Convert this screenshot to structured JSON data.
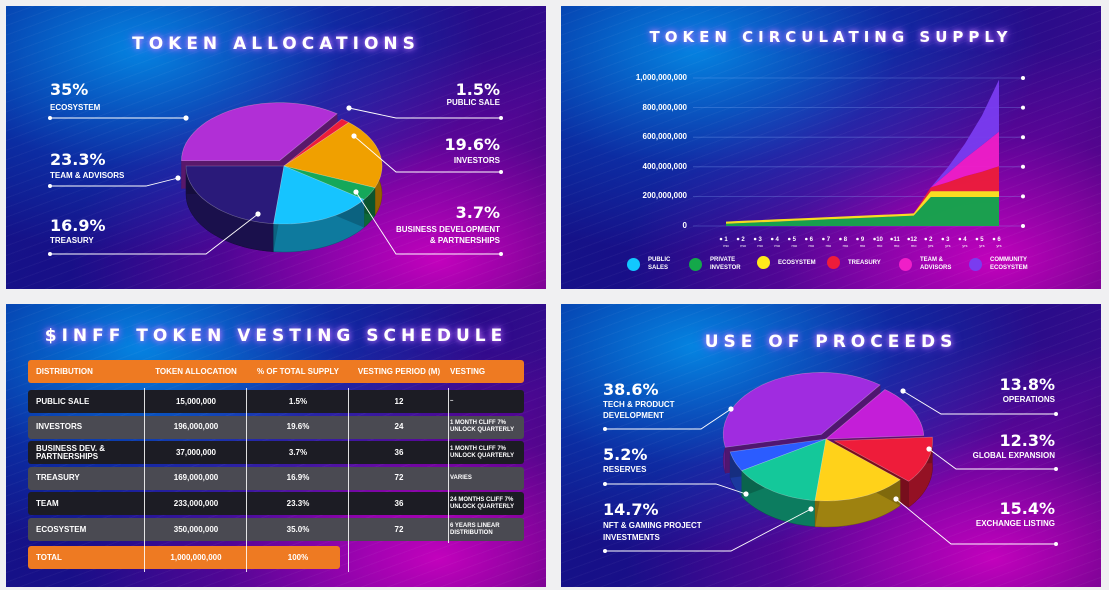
{
  "allocations": {
    "title": "TOKEN ALLOCATIONS",
    "colors": {
      "ecosystem": "#b12fd6",
      "team": "#2a1a7a",
      "treasury": "#16c4ff",
      "business": "#15a85a",
      "investors": "#f0a000",
      "public": "#ee1c3a",
      "yellow": "#ffe01a"
    },
    "chart_data": {
      "type": "pie",
      "title": "TOKEN ALLOCATIONS",
      "slices": [
        {
          "name": "ECOSYSTEM",
          "value": 35,
          "pct": "35%"
        },
        {
          "name": "TEAM & ADVISORS",
          "value": 23.3,
          "pct": "23.3%"
        },
        {
          "name": "TREASURY",
          "value": 16.9,
          "pct": "16.9%"
        },
        {
          "name": "BUSINESS DEVELOPMENT & PARTNERSHIPS",
          "value": 3.7,
          "pct": "3.7%"
        },
        {
          "name": "INVESTORS",
          "value": 19.6,
          "pct": "19.6%"
        },
        {
          "name": "PUBLIC SALE",
          "value": 1.5,
          "pct": "1.5%"
        }
      ]
    },
    "labels": {
      "eco_pct": "35%",
      "eco_name": "ECOSYSTEM",
      "team_pct": "23.3%",
      "team_name": "TEAM & ADVISORS",
      "tre_pct": "16.9%",
      "tre_name": "TREASURY",
      "pub_pct": "1.5%",
      "pub_name": "PUBLIC SALE",
      "inv_pct": "19.6%",
      "inv_name": "INVESTORS",
      "bus_pct": "3.7%",
      "bus_name1": "BUSINESS DEVELOPMENT",
      "bus_name2": "& PARTNERSHIPS"
    }
  },
  "supply": {
    "title": "TOKEN CIRCULATING SUPPLY",
    "chart_data": {
      "type": "area",
      "title": "TOKEN CIRCULATING SUPPLY",
      "ylim": [
        0,
        1000000000
      ],
      "yticks": [
        "1,000,000,000",
        "800,000,000",
        "600,000,000",
        "400,000,000",
        "200,000,000",
        "0"
      ],
      "ytick_values": [
        1000000000,
        800000000,
        600000000,
        400000000,
        200000000,
        0
      ],
      "x_labels": [
        {
          "n": "1",
          "u": "mo"
        },
        {
          "n": "2",
          "u": "mo"
        },
        {
          "n": "3",
          "u": "mo"
        },
        {
          "n": "4",
          "u": "mo"
        },
        {
          "n": "5",
          "u": "mo"
        },
        {
          "n": "6",
          "u": "mo"
        },
        {
          "n": "7",
          "u": "mo"
        },
        {
          "n": "8",
          "u": "mo"
        },
        {
          "n": "9",
          "u": "mo"
        },
        {
          "n": "10",
          "u": "mo"
        },
        {
          "n": "11",
          "u": "mo"
        },
        {
          "n": "12",
          "u": "mo"
        },
        {
          "n": "2",
          "u": "yrs"
        },
        {
          "n": "3",
          "u": "yrs"
        },
        {
          "n": "4",
          "u": "yrs"
        },
        {
          "n": "5",
          "u": "yrs"
        },
        {
          "n": "6",
          "u": "yrs"
        }
      ],
      "stacked": true,
      "series": [
        {
          "name": "PRIVATE INVESTOR",
          "color": "#14a84a",
          "values": [
            15000000,
            20000000,
            25000000,
            30000000,
            35000000,
            40000000,
            45000000,
            50000000,
            55000000,
            60000000,
            65000000,
            70000000,
            196000000,
            196000000,
            196000000,
            196000000,
            196000000
          ]
        },
        {
          "name": "ECOSYSTEM",
          "color": "#ffe81a",
          "values": [
            15000000,
            15000000,
            15000000,
            15000000,
            15000000,
            15000000,
            15000000,
            15000000,
            15000000,
            15000000,
            15000000,
            15000000,
            40000000,
            40000000,
            40000000,
            40000000,
            40000000
          ]
        },
        {
          "name": "TREASURY",
          "color": "#ee1c3a",
          "values": [
            0,
            0,
            0,
            0,
            0,
            0,
            0,
            0,
            0,
            0,
            0,
            0,
            25000000,
            60000000,
            100000000,
            130000000,
            169000000
          ]
        },
        {
          "name": "TEAM & ADVISORS",
          "color": "#f01ec8",
          "values": [
            0,
            0,
            0,
            0,
            0,
            0,
            0,
            0,
            0,
            0,
            0,
            0,
            0,
            60000000,
            120000000,
            180000000,
            233000000
          ]
        },
        {
          "name": "COMMUNITY ECOSYSTEM",
          "color": "#7a3cf0",
          "values": [
            0,
            0,
            0,
            0,
            0,
            0,
            0,
            0,
            0,
            0,
            0,
            0,
            0,
            40000000,
            100000000,
            200000000,
            350000000
          ]
        }
      ]
    },
    "legend": [
      {
        "label": "PUBLIC SALES",
        "l1": "PUBLIC",
        "l2": "SALES",
        "color": "#12c8ff"
      },
      {
        "label": "PRIVATE INVESTOR",
        "l1": "PRIVATE",
        "l2": "INVESTOR",
        "color": "#14a84a"
      },
      {
        "label": "ECOSYSTEM",
        "l1": "ECOSYSTEM",
        "l2": "",
        "color": "#ffe81a"
      },
      {
        "label": "TREASURY",
        "l1": "TREASURY",
        "l2": "",
        "color": "#ee1c3a"
      },
      {
        "label": "TEAM & ADVISORS",
        "l1": "TEAM &",
        "l2": "ADVISORS",
        "color": "#f01ec8"
      },
      {
        "label": "COMMUNITY ECOSYSTEM",
        "l1": "COMMUNITY",
        "l2": "ECOSYSTEM",
        "color": "#7a3cf0"
      }
    ]
  },
  "vesting": {
    "title": "$INFF TOKEN VESTING SCHEDULE",
    "chart_data": {
      "type": "table",
      "headers": [
        "DISTRIBUTION",
        "TOKEN ALLOCATION",
        "% OF TOTAL SUPPLY",
        "VESTING PERIOD (M)",
        "VESTING"
      ],
      "rows": [
        [
          "PUBLIC SALE",
          "15,000,000",
          "1.5%",
          "12",
          "–"
        ],
        [
          "INVESTORS",
          "196,000,000",
          "19.6%",
          "24",
          "1 MONTH CLIFF 7% UNLOCK QUARTERLY"
        ],
        [
          "BUSINESS DEV. & PARTNERSHIPS",
          "37,000,000",
          "3.7%",
          "36",
          "1 MONTH CLIFF 7% UNLOCK QUARTERLY"
        ],
        [
          "TREASURY",
          "169,000,000",
          "16.9%",
          "72",
          "VARIES"
        ],
        [
          "TEAM",
          "233,000,000",
          "23.3%",
          "36",
          "24 MONTHS CLIFF 7% UNLOCK QUARTERLY"
        ],
        [
          "ECOSYSTEM",
          "350,000,000",
          "35.0%",
          "72",
          "6 YEARS LINEAR DISTRIBUTION"
        ]
      ],
      "total": [
        "TOTAL",
        "1,000,000,000",
        "100%"
      ]
    }
  },
  "proceeds": {
    "title": "USE OF PROCEEDS",
    "chart_data": {
      "type": "pie",
      "title": "USE OF PROCEEDS",
      "slices": [
        {
          "name": "TECH & PRODUCT DEVELOPMENT",
          "value": 38.6,
          "pct": "38.6%",
          "color": "#a02ce0"
        },
        {
          "name": "OPERATIONS",
          "value": 13.8,
          "pct": "13.8%",
          "color": "#c41ed8"
        },
        {
          "name": "GLOBAL EXPANSION",
          "value": 12.3,
          "pct": "12.3%",
          "color": "#ee1c3a"
        },
        {
          "name": "EXCHANGE LISTING",
          "value": 15.4,
          "pct": "15.4%",
          "color": "#ffd21a"
        },
        {
          "name": "NFT & GAMING PROJECT INVESTMENTS",
          "value": 14.7,
          "pct": "14.7%",
          "color": "#14c89a"
        },
        {
          "name": "RESERVES",
          "value": 5.2,
          "pct": "5.2%",
          "color": "#2b5cff"
        }
      ]
    },
    "labels": {
      "tech_pct": "38.6%",
      "tech_l1": "TECH & PRODUCT",
      "tech_l2": "DEVELOPMENT",
      "res_pct": "5.2%",
      "res_name": "RESERVES",
      "nft_pct": "14.7%",
      "nft_l1": "NFT & GAMING PROJECT",
      "nft_l2": "INVESTMENTS",
      "ops_pct": "13.8%",
      "ops_name": "OPERATIONS",
      "glo_pct": "12.3%",
      "glo_name": "GLOBAL EXPANSION",
      "exc_pct": "15.4%",
      "exc_name": "EXCHANGE LISTING"
    }
  }
}
